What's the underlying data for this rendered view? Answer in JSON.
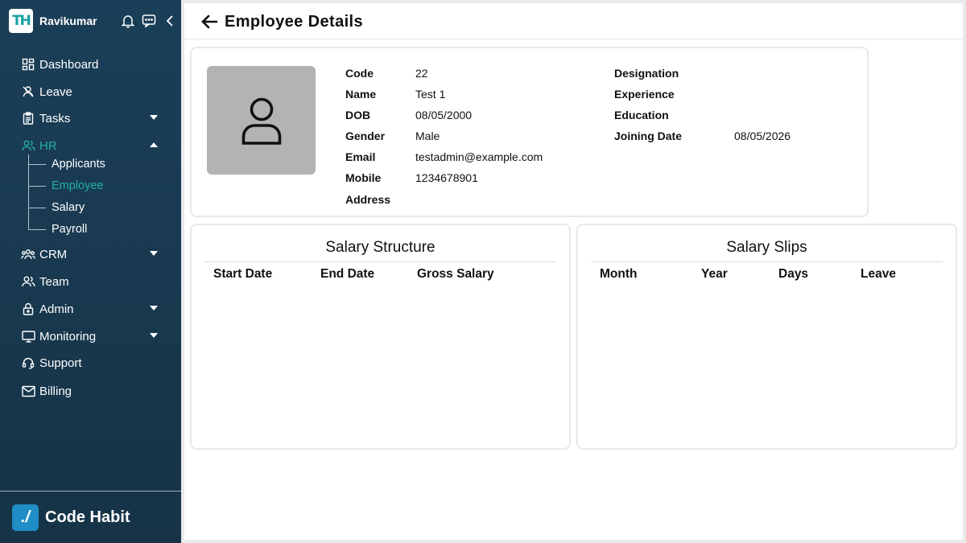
{
  "sidebar": {
    "logo_text": "TH",
    "user_name": "Ravikumar",
    "nav": {
      "dashboard": "Dashboard",
      "leave": "Leave",
      "tasks": "Tasks",
      "hr": "HR",
      "crm": "CRM",
      "team": "Team",
      "admin": "Admin",
      "monitoring": "Monitoring",
      "support": "Support",
      "billing": "Billing"
    },
    "hr_sub": {
      "applicants": "Applicants",
      "employee": "Employee",
      "salary": "Salary",
      "payroll": "Payroll"
    },
    "brand": {
      "icon_text": "./",
      "name": "Code Habit"
    },
    "accent_color": "#22b0a8"
  },
  "header": {
    "title": "Employee Details"
  },
  "employee": {
    "labels": {
      "code": "Code",
      "name": "Name",
      "dob": "DOB",
      "gender": "Gender",
      "email": "Email",
      "mobile": "Mobile",
      "address": "Address",
      "designation": "Designation",
      "experience": "Experience",
      "education": "Education",
      "joining_date": "Joining Date"
    },
    "values": {
      "code": "22",
      "name": "Test 1",
      "dob": "08/05/2000",
      "gender": "Male",
      "email": "testadmin@example.com",
      "mobile": "1234678901",
      "address": "",
      "designation": "",
      "experience": "",
      "education": "",
      "joining_date": "08/05/2026"
    }
  },
  "salary_structure": {
    "title": "Salary Structure",
    "columns": [
      "Start Date",
      "End Date",
      "Gross Salary"
    ],
    "rows": []
  },
  "salary_slips": {
    "title": "Salary Slips",
    "columns": [
      "Month",
      "Year",
      "Days",
      "Leave"
    ],
    "rows": []
  }
}
